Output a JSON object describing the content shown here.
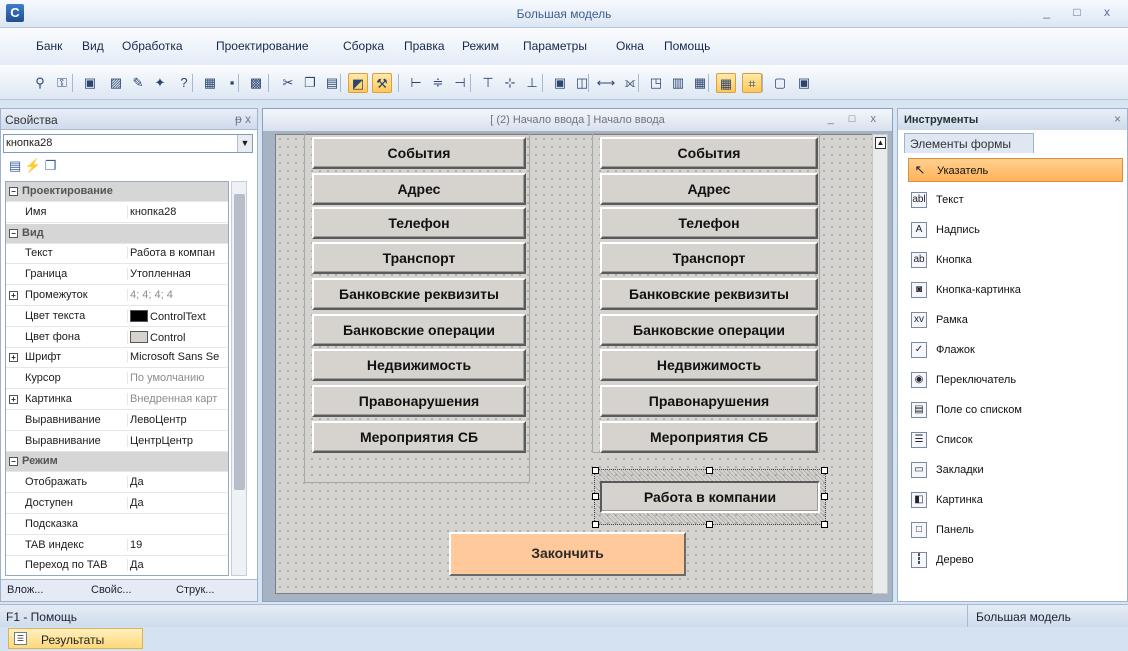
{
  "window": {
    "title": "Большая модель",
    "app_icon": "C",
    "controls": "_ □ x"
  },
  "menu": [
    "Банк",
    "Вид",
    "Обработка",
    "Проектирование",
    "Сборка",
    "Правка",
    "Режим",
    "Параметры",
    "Окна",
    "Помощь"
  ],
  "toolbar_icons": [
    "binoculars-icon",
    "find-icon",
    "form-icon",
    "edit-form-icon",
    "pencil-icon",
    "wizard-icon",
    "help-icon",
    "view-icon",
    "save-icon",
    "save-all-icon",
    "cut-icon",
    "copy-icon",
    "paste-icon",
    "design-mode-icon",
    "tools-icon",
    "align-left-icon",
    "align-center-icon",
    "align-right-icon",
    "align-top-icon",
    "align-middle-icon",
    "align-bottom-icon",
    "size-icon",
    "size2-icon",
    "hspace-icon",
    "vspace-icon",
    "order-icon",
    "group-icon",
    "ungroup-icon",
    "grid-icon",
    "snap-icon",
    "bring-front-icon",
    "send-back-icon"
  ],
  "props": {
    "title": "Свойства",
    "pin": "ᵽ x",
    "selected": "кнопка28",
    "tool_glyphs": "▤ ⚡ ❐",
    "rows": [
      {
        "type": "cat",
        "key": "Проектирование",
        "exp": "−"
      },
      {
        "key": "Имя",
        "value": "кнопка28"
      },
      {
        "type": "cat",
        "key": "Вид",
        "exp": "−"
      },
      {
        "key": "Текст",
        "value": "Работа в компан"
      },
      {
        "key": "Граница",
        "value": "Утопленная"
      },
      {
        "key": "Промежуток",
        "value": "4; 4; 4; 4",
        "exp": "+",
        "gray": true
      },
      {
        "key": "Цвет текста",
        "value": "ControlText",
        "swatch": "#000000"
      },
      {
        "key": "Цвет фона",
        "value": "Control",
        "swatch": "#d6d3ce"
      },
      {
        "key": "Шрифт",
        "value": "Microsoft Sans Se",
        "exp": "+"
      },
      {
        "key": "Курсор",
        "value": "По умолчанию",
        "gray": true
      },
      {
        "key": "Картинка",
        "value": "Внедренная карт",
        "exp": "+",
        "gray": true
      },
      {
        "key": "Выравнивание",
        "value": "ЛевоЦентр"
      },
      {
        "key": "Выравнивание",
        "value": "ЦентрЦентр"
      },
      {
        "type": "cat",
        "key": "Режим",
        "exp": "−"
      },
      {
        "key": "Отображать",
        "value": "Да"
      },
      {
        "key": "Доступен",
        "value": "Да"
      },
      {
        "key": "Подсказка",
        "value": ""
      },
      {
        "key": "TAB индекс",
        "value": "19"
      },
      {
        "key": "Переход по TAB",
        "value": "Да"
      }
    ],
    "tabs": [
      "Влож...",
      "Свойс...",
      "Струк..."
    ]
  },
  "designer": {
    "title": "[ (2) Начало ввода ] Начало ввода",
    "controls": "_ □ x",
    "buttons": [
      "События",
      "Адрес",
      "Телефон",
      "Транспорт",
      "Банковские реквизиты",
      "Банковские операции",
      "Недвижимость",
      "Правонарушения",
      "Мероприятия СБ"
    ],
    "selected_button": "Работа в компании",
    "finish_button": "Закончить"
  },
  "tools": {
    "title": "Инструменты",
    "tab": "Элементы формы",
    "items": [
      {
        "label": "Указатель",
        "icon": "↖",
        "selected": true
      },
      {
        "label": "Текст",
        "icon": "abl"
      },
      {
        "label": "Надпись",
        "icon": "A"
      },
      {
        "label": "Кнопка",
        "icon": "ab"
      },
      {
        "label": "Кнопка-картинка",
        "icon": "◙"
      },
      {
        "label": "Рамка",
        "icon": "xv"
      },
      {
        "label": "Флажок",
        "icon": "✓"
      },
      {
        "label": "Переключатель",
        "icon": "◉"
      },
      {
        "label": "Поле со списком",
        "icon": "▤"
      },
      {
        "label": "Список",
        "icon": "☰"
      },
      {
        "label": "Закладки",
        "icon": "▭"
      },
      {
        "label": "Картинка",
        "icon": "◧"
      },
      {
        "label": "Панель",
        "icon": "□"
      },
      {
        "label": "Дерево",
        "icon": "┇"
      }
    ]
  },
  "status": {
    "help": "F1 - Помощь",
    "model": "Большая модель"
  },
  "results_tab": "Результаты"
}
